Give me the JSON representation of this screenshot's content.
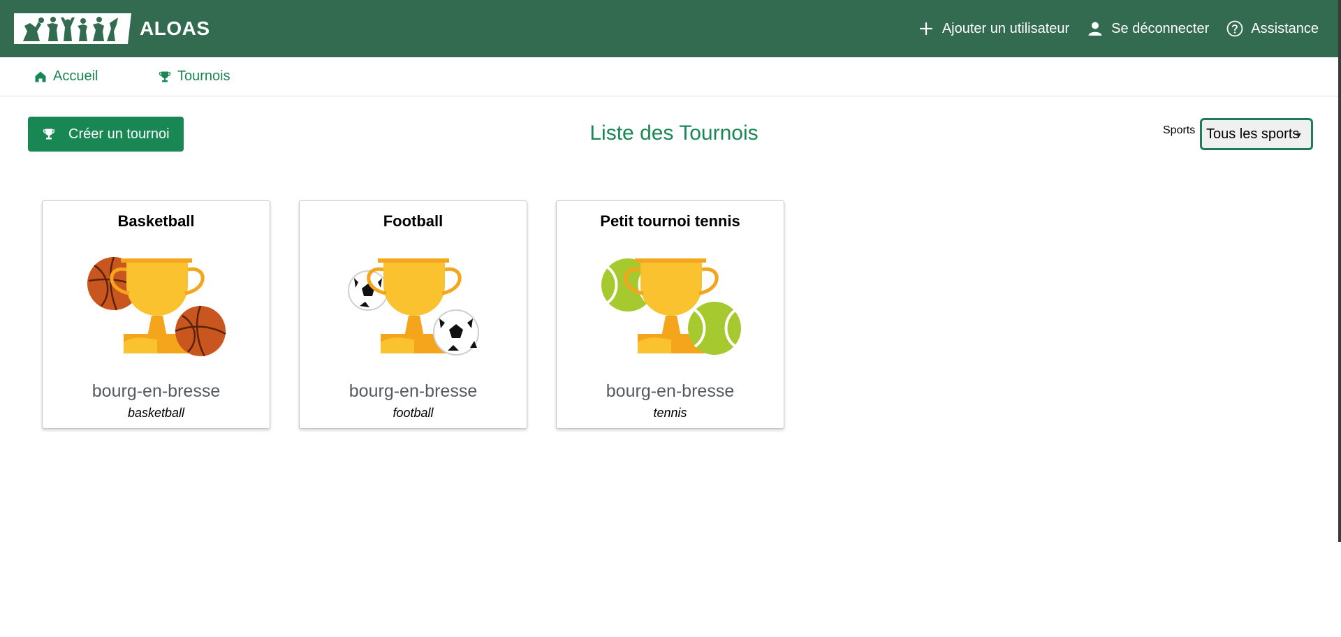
{
  "header": {
    "brand": "ALOAS",
    "actions": [
      {
        "label": "Ajouter un utilisateur",
        "icon": "plus-icon"
      },
      {
        "label": "Se déconnecter",
        "icon": "user-icon"
      },
      {
        "label": "Assistance",
        "icon": "help-circle-icon"
      }
    ]
  },
  "nav": {
    "home_label": "Accueil",
    "tournois_label": "Tournois"
  },
  "toolbar": {
    "create_label": "Créer un tournoi",
    "title": "Liste des Tournois",
    "sports_label": "Sports",
    "sports_selected": "Tous les sports"
  },
  "tournaments": [
    {
      "name": "Basketball",
      "city": "bourg-en-bresse",
      "sport": "basketball",
      "image": "trophy-basketball"
    },
    {
      "name": "Football",
      "city": "bourg-en-bresse",
      "sport": "football",
      "image": "trophy-football"
    },
    {
      "name": "Petit tournoi tennis",
      "city": "bourg-en-bresse",
      "sport": "tennis",
      "image": "trophy-tennis"
    }
  ],
  "colors": {
    "header_bg": "#336b51",
    "accent": "#198754",
    "trophy": "#f9c22e",
    "trophy_dark": "#f4a51c"
  }
}
